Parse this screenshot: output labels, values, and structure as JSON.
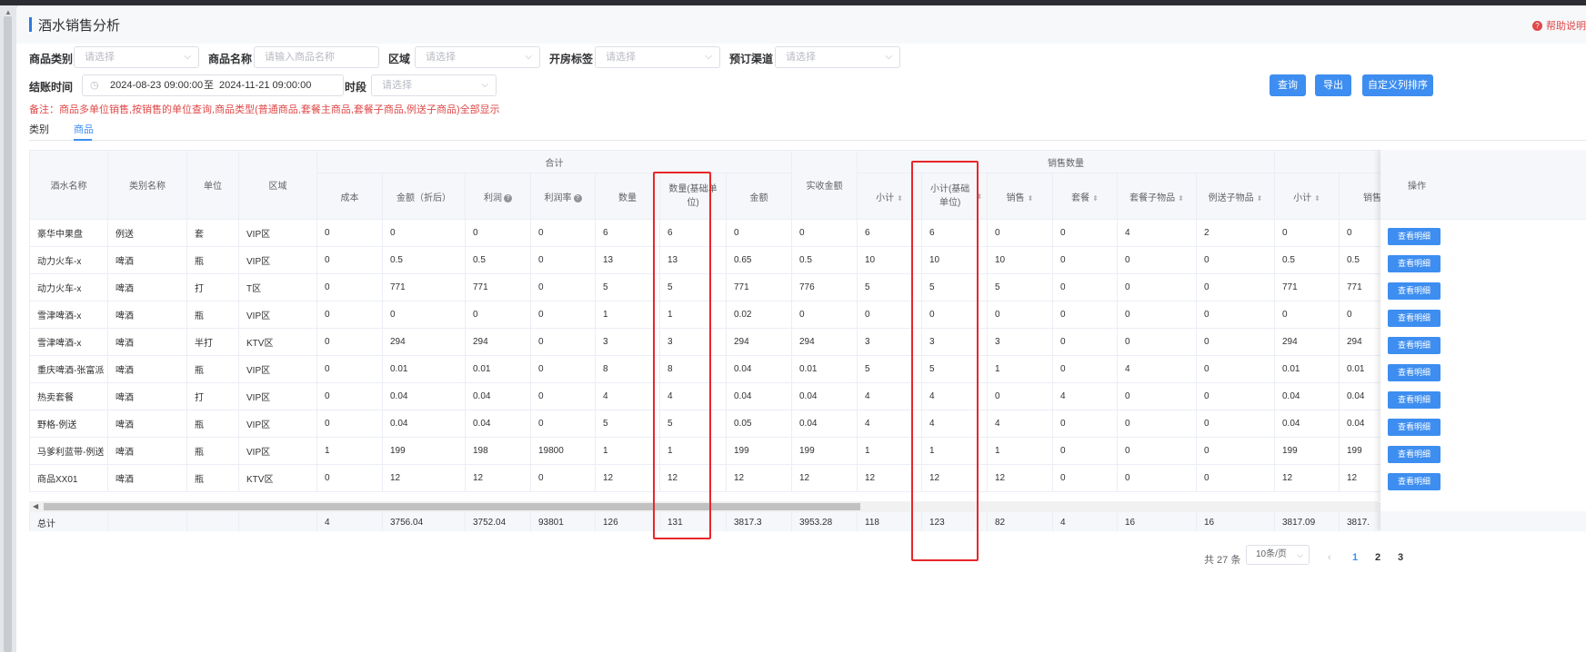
{
  "title": "酒水销售分析",
  "help": "帮助说明",
  "filters": {
    "category_label": "商品类别",
    "category_ph": "请选择",
    "name_label": "商品名称",
    "name_ph": "请输入商品名称",
    "area_label": "区域",
    "area_ph": "请选择",
    "room_tag_label": "开房标签",
    "room_tag_ph": "请选择",
    "channel_label": "预订渠道",
    "channel_ph": "请选择",
    "checkout_label": "结账时间",
    "date_start": "2024-08-23 09:00:00",
    "date_sep": "至",
    "date_end": "2024-11-21 09:00:00",
    "period_label": "时段",
    "period_ph": "请选择"
  },
  "buttons": {
    "query": "查询",
    "export": "导出",
    "custom_cols": "自定义列排序"
  },
  "note": "备注：商品多单位销售,按销售的单位查询,商品类型(普通商品,套餐主商品,套餐子商品,例送子商品)全部显示",
  "tabs": [
    "类别",
    "商品"
  ],
  "colors": {
    "accent": "#3d8ef0",
    "note": "#e04848",
    "highlight": "#e8262a"
  },
  "table": {
    "group_headers": {
      "total": "合计",
      "sales_qty": "销售数量"
    },
    "headers": {
      "name": "酒水名称",
      "category": "类别名称",
      "unit": "单位",
      "area": "区域",
      "cost": "成本",
      "amount": "金额（折后）",
      "profit": "利润",
      "margin": "利润率",
      "qty": "数量",
      "qty_base": "数量(基础单位)",
      "amt": "金额",
      "received": "实收金额",
      "subtotal": "小计",
      "subtotal_base": "小计(基础单位)",
      "sale": "销售",
      "pkg": "套餐",
      "pkg_child": "套餐子物品",
      "gift_child": "例送子物品",
      "subtotal2": "小计",
      "sale2": "销售",
      "op": "操作"
    },
    "rows": [
      [
        "豪华中果盘",
        "例送",
        "套",
        "VIP区",
        "0",
        "0",
        "0",
        "0",
        "6",
        "6",
        "0",
        "0",
        "6",
        "6",
        "0",
        "0",
        "4",
        "2",
        "0",
        "0"
      ],
      [
        "动力火车-x",
        "啤酒",
        "瓶",
        "VIP区",
        "0",
        "0.5",
        "0.5",
        "0",
        "13",
        "13",
        "0.65",
        "0.5",
        "10",
        "10",
        "10",
        "0",
        "0",
        "0",
        "0.5",
        "0.5"
      ],
      [
        "动力火车-x",
        "啤酒",
        "打",
        "T区",
        "0",
        "771",
        "771",
        "0",
        "5",
        "5",
        "771",
        "776",
        "5",
        "5",
        "5",
        "0",
        "0",
        "0",
        "771",
        "771"
      ],
      [
        "雪津啤酒-x",
        "啤酒",
        "瓶",
        "VIP区",
        "0",
        "0",
        "0",
        "0",
        "1",
        "1",
        "0.02",
        "0",
        "0",
        "0",
        "0",
        "0",
        "0",
        "0",
        "0",
        "0"
      ],
      [
        "雪津啤酒-x",
        "啤酒",
        "半打",
        "KTV区",
        "0",
        "294",
        "294",
        "0",
        "3",
        "3",
        "294",
        "294",
        "3",
        "3",
        "3",
        "0",
        "0",
        "0",
        "294",
        "294"
      ],
      [
        "重庆啤酒-张富派",
        "啤酒",
        "瓶",
        "VIP区",
        "0",
        "0.01",
        "0.01",
        "0",
        "8",
        "8",
        "0.04",
        "0.01",
        "5",
        "5",
        "1",
        "0",
        "4",
        "0",
        "0.01",
        "0.01"
      ],
      [
        "热卖套餐",
        "啤酒",
        "打",
        "VIP区",
        "0",
        "0.04",
        "0.04",
        "0",
        "4",
        "4",
        "0.04",
        "0.04",
        "4",
        "4",
        "0",
        "4",
        "0",
        "0",
        "0.04",
        "0.04"
      ],
      [
        "野格-例送",
        "啤酒",
        "瓶",
        "VIP区",
        "0",
        "0.04",
        "0.04",
        "0",
        "5",
        "5",
        "0.05",
        "0.04",
        "4",
        "4",
        "4",
        "0",
        "0",
        "0",
        "0.04",
        "0.04"
      ],
      [
        "马爹利蓝带-例送",
        "啤酒",
        "瓶",
        "VIP区",
        "1",
        "199",
        "198",
        "19800",
        "1",
        "1",
        "199",
        "199",
        "1",
        "1",
        "1",
        "0",
        "0",
        "0",
        "199",
        "199"
      ],
      [
        "商品XX01",
        "啤酒",
        "瓶",
        "KTV区",
        "0",
        "12",
        "12",
        "0",
        "12",
        "12",
        "12",
        "12",
        "12",
        "12",
        "12",
        "0",
        "0",
        "0",
        "12",
        "12"
      ]
    ],
    "total_row": [
      "总计",
      "",
      "",
      "",
      "4",
      "3756.04",
      "3752.04",
      "93801",
      "126",
      "131",
      "3817.3",
      "3953.28",
      "118",
      "123",
      "82",
      "4",
      "16",
      "16",
      "3817.09",
      "3817."
    ],
    "detail_button": "查看明细"
  },
  "pagination": {
    "total": "共 27 条",
    "page_size": "10条/页",
    "pages": [
      "1",
      "2",
      "3"
    ],
    "current": "1"
  }
}
